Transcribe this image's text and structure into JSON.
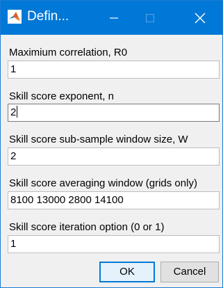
{
  "window": {
    "title": "Defin..."
  },
  "fields": [
    {
      "label": "Maximium correlation, R0",
      "value": "1"
    },
    {
      "label": "Skill score exponent, n",
      "value": "2"
    },
    {
      "label": "Skill score sub-sample window size, W",
      "value": "2"
    },
    {
      "label": "Skill score averaging window (grids only)",
      "value": "8100 13000 2800 14100"
    },
    {
      "label": "Skill score iteration option (0 or 1)",
      "value": "1"
    }
  ],
  "buttons": {
    "ok_label": "OK",
    "cancel_label": "Cancel"
  },
  "icons": {
    "app": "matlab-icon",
    "minimize": "minimize-icon",
    "maximize": "maximize-icon",
    "close": "close-icon"
  },
  "colors": {
    "titlebar": "#0078d7",
    "background": "#f0f0f0",
    "ok_border": "#0078d7"
  }
}
